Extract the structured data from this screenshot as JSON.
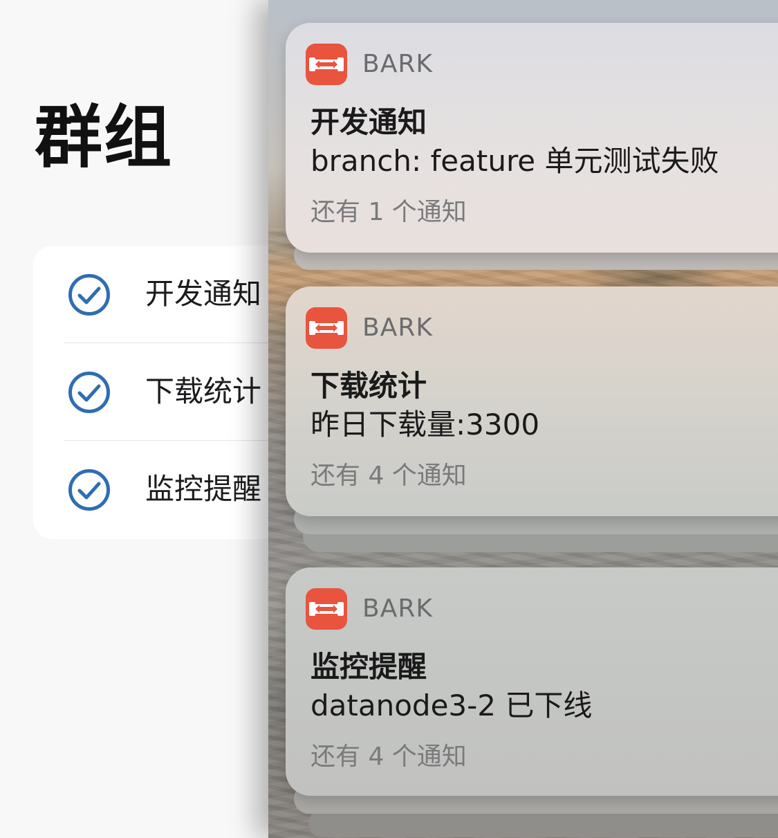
{
  "page": {
    "title": "群组"
  },
  "groups": [
    {
      "label": "开发通知",
      "checked": true,
      "icon": "checkmark-circle-icon"
    },
    {
      "label": "下载统计",
      "checked": true,
      "icon": "checkmark-circle-icon"
    },
    {
      "label": "监控提醒",
      "checked": true,
      "icon": "checkmark-circle-icon"
    }
  ],
  "notifications": [
    {
      "app_name": "BARK",
      "title": "开发通知",
      "body": "branch: feature 单元测试失败",
      "more": "还有 1 个通知"
    },
    {
      "app_name": "BARK",
      "title": "下载统计",
      "body": "昨日下载量:3300",
      "more": "还有 4 个通知"
    },
    {
      "app_name": "BARK",
      "title": "监控提醒",
      "body": "datanode3-2 已下线",
      "more": "还有 4 个通知"
    }
  ],
  "colors": {
    "accent": "#2f6db3",
    "app_icon": "#e9543f"
  }
}
